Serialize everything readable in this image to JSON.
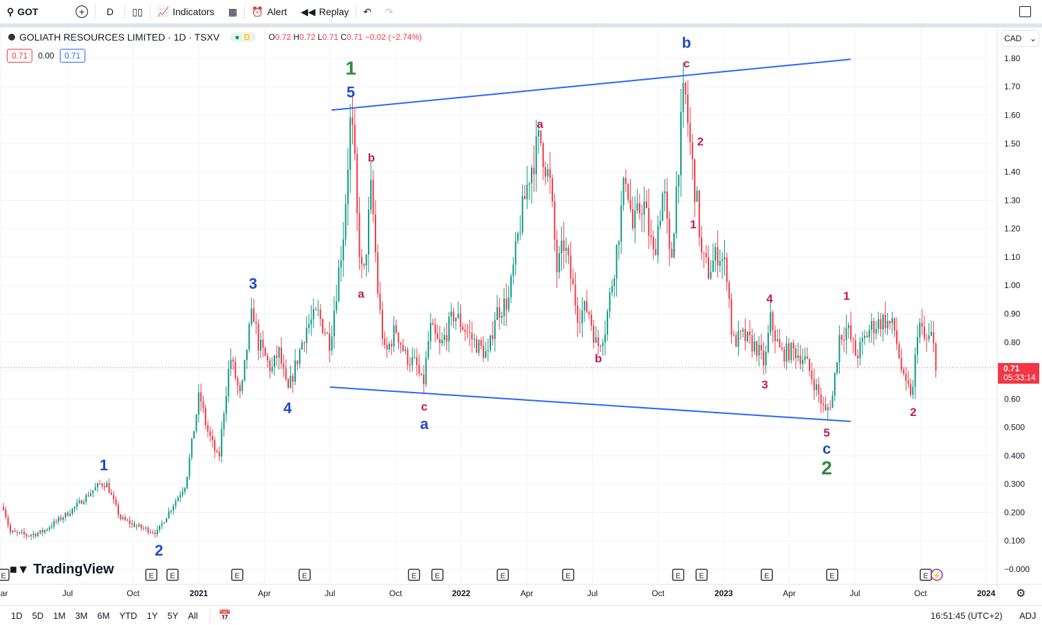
{
  "toolbar": {
    "symbol": "GOT",
    "interval": "D",
    "indicators": "Indicators",
    "alert": "Alert",
    "replay": "Replay"
  },
  "legend": {
    "title": "GOLIATH RESOURCES LIMITED · 1D · TSXV",
    "badge": "D",
    "o_label": "O",
    "o": "0.72",
    "h_label": "H",
    "h": "0.72",
    "l_label": "L",
    "l": "0.71",
    "c_label": "C",
    "c": "0.71",
    "change": "−0.02 (−2.74%)",
    "bid": "0.71",
    "spread": "0.00",
    "ask": "0.71"
  },
  "currency": "CAD",
  "last_price": {
    "price": "0.71",
    "countdown": "05:33:14"
  },
  "bottom": {
    "ranges": [
      "1D",
      "5D",
      "1M",
      "3M",
      "6M",
      "YTD",
      "1Y",
      "5Y",
      "All"
    ],
    "clock": "16:51:45 (UTC+2)",
    "adj": "ADJ"
  },
  "logo_text": "TradingView",
  "colors": {
    "up": "#089981",
    "down": "#f23645",
    "wave_blue": "#2349c4",
    "wave_magenta": "#c2185b",
    "wave_green": "#2e8b3e",
    "trend": "#2962ff"
  },
  "chart_data": {
    "type": "candlestick",
    "title": "GOLIATH RESOURCES LIMITED · 1D · TSXV",
    "x_unit": "months since Jan 2020",
    "ylim": [
      0,
      1.8
    ],
    "y_ticks": [
      "1.80",
      "1.70",
      "1.60",
      "1.50",
      "1.40",
      "1.30",
      "1.20",
      "1.10",
      "1.00",
      "0.90",
      "0.80",
      "0.70",
      "0.60",
      "0.500",
      "0.400",
      "0.300",
      "0.200",
      "0.100",
      "−0.000"
    ],
    "y_tick_values": [
      1.8,
      1.7,
      1.6,
      1.5,
      1.4,
      1.3,
      1.2,
      1.1,
      1.0,
      0.9,
      0.8,
      0.7,
      0.6,
      0.5,
      0.4,
      0.3,
      0.2,
      0.1,
      0
    ],
    "x_ticks": [
      {
        "m": 2,
        "label": "Mar"
      },
      {
        "m": 6,
        "label": "Jul"
      },
      {
        "m": 9,
        "label": "Oct"
      },
      {
        "m": 12,
        "label": "2021"
      },
      {
        "m": 15,
        "label": "Apr"
      },
      {
        "m": 18,
        "label": "Jul"
      },
      {
        "m": 21,
        "label": "Oct"
      },
      {
        "m": 24,
        "label": "2022"
      },
      {
        "m": 27,
        "label": "Apr"
      },
      {
        "m": 30,
        "label": "Jul"
      },
      {
        "m": 33,
        "label": "Oct"
      },
      {
        "m": 36,
        "label": "2023"
      },
      {
        "m": 39,
        "label": "Apr"
      },
      {
        "m": 42,
        "label": "Jul"
      },
      {
        "m": 45,
        "label": "Oct"
      },
      {
        "m": 48,
        "label": "2024"
      }
    ],
    "price_path": [
      [
        3.07,
        0.22
      ],
      [
        3.38,
        0.13
      ],
      [
        4.17,
        0.12
      ],
      [
        4.8,
        0.13
      ],
      [
        6.06,
        0.2
      ],
      [
        7.47,
        0.3
      ],
      [
        7.79,
        0.3
      ],
      [
        8.41,
        0.18
      ],
      [
        9.2,
        0.15
      ],
      [
        10.1,
        0.13
      ],
      [
        10.46,
        0.18
      ],
      [
        11.4,
        0.3
      ],
      [
        12.03,
        0.62
      ],
      [
        12.35,
        0.5
      ],
      [
        12.91,
        0.38
      ],
      [
        13.13,
        0.55
      ],
      [
        13.44,
        0.75
      ],
      [
        13.92,
        0.6
      ],
      [
        14.23,
        0.8
      ],
      [
        14.48,
        0.92
      ],
      [
        14.7,
        0.8
      ],
      [
        15.33,
        0.7
      ],
      [
        15.65,
        0.77
      ],
      [
        16.06,
        0.62
      ],
      [
        16.43,
        0.72
      ],
      [
        16.9,
        0.85
      ],
      [
        17.44,
        0.9
      ],
      [
        18.0,
        0.8
      ],
      [
        18.32,
        1.0
      ],
      [
        18.63,
        1.2
      ],
      [
        18.95,
        1.6
      ],
      [
        19.11,
        1.45
      ],
      [
        19.26,
        1.2
      ],
      [
        19.51,
        1.0
      ],
      [
        19.89,
        1.35
      ],
      [
        20.21,
        0.95
      ],
      [
        20.52,
        0.75
      ],
      [
        21.0,
        0.85
      ],
      [
        21.46,
        0.75
      ],
      [
        21.94,
        0.72
      ],
      [
        22.25,
        0.64
      ],
      [
        22.57,
        0.85
      ],
      [
        23.04,
        0.78
      ],
      [
        23.67,
        0.9
      ],
      [
        24.14,
        0.85
      ],
      [
        24.61,
        0.8
      ],
      [
        25.24,
        0.75
      ],
      [
        25.55,
        0.9
      ],
      [
        26.18,
        0.95
      ],
      [
        26.65,
        1.2
      ],
      [
        27.13,
        1.4
      ],
      [
        27.6,
        1.52
      ],
      [
        28.07,
        1.35
      ],
      [
        28.38,
        1.05
      ],
      [
        28.7,
        1.15
      ],
      [
        29.33,
        0.9
      ],
      [
        29.8,
        0.92
      ],
      [
        30.21,
        0.78
      ],
      [
        30.58,
        0.85
      ],
      [
        31.06,
        1.1
      ],
      [
        31.53,
        1.4
      ],
      [
        31.84,
        1.2
      ],
      [
        32.32,
        1.3
      ],
      [
        32.79,
        1.1
      ],
      [
        33.26,
        1.35
      ],
      [
        33.57,
        1.05
      ],
      [
        33.89,
        1.4
      ],
      [
        34.2,
        1.7
      ],
      [
        34.52,
        1.45
      ],
      [
        34.83,
        1.25
      ],
      [
        34.99,
        1.1
      ],
      [
        35.3,
        1.05
      ],
      [
        35.77,
        1.12
      ],
      [
        36.15,
        1.05
      ],
      [
        36.4,
        0.8
      ],
      [
        36.88,
        0.82
      ],
      [
        37.51,
        0.78
      ],
      [
        37.88,
        0.72
      ],
      [
        38.13,
        0.88
      ],
      [
        38.6,
        0.76
      ],
      [
        39.23,
        0.77
      ],
      [
        39.7,
        0.74
      ],
      [
        40.18,
        0.65
      ],
      [
        40.65,
        0.55
      ],
      [
        40.96,
        0.6
      ],
      [
        41.28,
        0.82
      ],
      [
        41.65,
        0.85
      ],
      [
        42.06,
        0.75
      ],
      [
        42.69,
        0.85
      ],
      [
        43.32,
        0.88
      ],
      [
        43.79,
        0.85
      ],
      [
        44.26,
        0.65
      ],
      [
        44.64,
        0.62
      ],
      [
        44.89,
        0.88
      ],
      [
        45.2,
        0.8
      ],
      [
        45.52,
        0.82
      ],
      [
        45.74,
        0.71
      ]
    ],
    "trendlines": [
      {
        "from": [
          18.07,
          1.618
        ],
        "to": [
          41.8,
          1.797
        ]
      },
      {
        "from": [
          18.0,
          0.642
        ],
        "to": [
          41.8,
          0.521
        ]
      }
    ],
    "wave_labels": [
      {
        "text": "1",
        "m": 18.95,
        "p": 1.76,
        "color": "green"
      },
      {
        "text": "5",
        "m": 18.95,
        "p": 1.68,
        "color": "blue"
      },
      {
        "text": "b",
        "m": 34.3,
        "p": 1.855,
        "color": "blue"
      },
      {
        "text": "c",
        "m": 34.3,
        "p": 1.785,
        "color": "magenta"
      },
      {
        "text": "a",
        "m": 27.6,
        "p": 1.572,
        "color": "magenta"
      },
      {
        "text": "b",
        "m": 19.89,
        "p": 1.453,
        "color": "magenta"
      },
      {
        "text": "a",
        "m": 19.42,
        "p": 0.974,
        "color": "magenta"
      },
      {
        "text": "2",
        "m": 34.93,
        "p": 1.51,
        "color": "magenta"
      },
      {
        "text": "1",
        "m": 34.61,
        "p": 1.218,
        "color": "magenta"
      },
      {
        "text": "3",
        "m": 14.48,
        "p": 1.005,
        "color": "blue"
      },
      {
        "text": "4",
        "m": 16.06,
        "p": 0.567,
        "color": "blue"
      },
      {
        "text": "1",
        "m": 7.66,
        "p": 0.366,
        "color": "blue"
      },
      {
        "text": "2",
        "m": 10.18,
        "p": 0.065,
        "color": "blue"
      },
      {
        "text": "c",
        "m": 22.31,
        "p": 0.577,
        "color": "magenta"
      },
      {
        "text": "a",
        "m": 22.31,
        "p": 0.511,
        "color": "blue"
      },
      {
        "text": "b",
        "m": 30.27,
        "p": 0.746,
        "color": "magenta"
      },
      {
        "text": "4",
        "m": 38.1,
        "p": 0.957,
        "color": "magenta"
      },
      {
        "text": "3",
        "m": 37.88,
        "p": 0.654,
        "color": "magenta"
      },
      {
        "text": "1",
        "m": 41.62,
        "p": 0.967,
        "color": "magenta"
      },
      {
        "text": "5",
        "m": 40.71,
        "p": 0.484,
        "color": "magenta"
      },
      {
        "text": "c",
        "m": 40.71,
        "p": 0.424,
        "color": "blue"
      },
      {
        "text": "2",
        "m": 40.71,
        "p": 0.351,
        "color": "green"
      },
      {
        "text": "2",
        "m": 44.67,
        "p": 0.557,
        "color": "magenta"
      }
    ],
    "earnings_events": [
      3.07,
      9.83,
      10.8,
      13.76,
      16.84,
      21.84,
      22.91,
      25.9,
      28.89,
      33.92,
      34.99,
      37.97,
      40.96,
      45.24
    ],
    "event_label": "E",
    "last_price_line": 0.71
  }
}
